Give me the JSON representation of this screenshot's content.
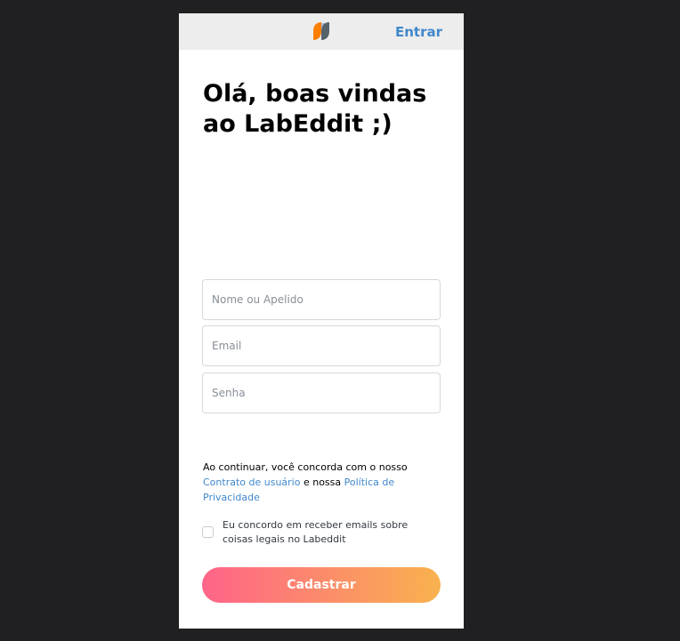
{
  "header": {
    "login_label": "Entrar"
  },
  "main": {
    "title": "Olá, boas vindas ao LabEddit ;)"
  },
  "form": {
    "name_placeholder": "Nome ou Apelido",
    "email_placeholder": "Email",
    "password_placeholder": "Senha"
  },
  "terms": {
    "prefix": "Ao continuar, você concorda com o nosso ",
    "contract_link": "Contrato de usuário",
    "middle": " e nossa ",
    "privacy_link": "Política de Privacidade"
  },
  "consent": {
    "label": "Eu concordo em receber emails sobre coisas legais no Labeddit",
    "checked": false
  },
  "actions": {
    "signup_label": "Cadastrar"
  },
  "colors": {
    "page_background": "#202022",
    "header_background": "#ededed",
    "link": "#4088cb",
    "button_gradient_start": "#ff6489",
    "button_gradient_end": "#f9b24e"
  },
  "icons": {
    "logo": "labeddit-logo-icon"
  }
}
